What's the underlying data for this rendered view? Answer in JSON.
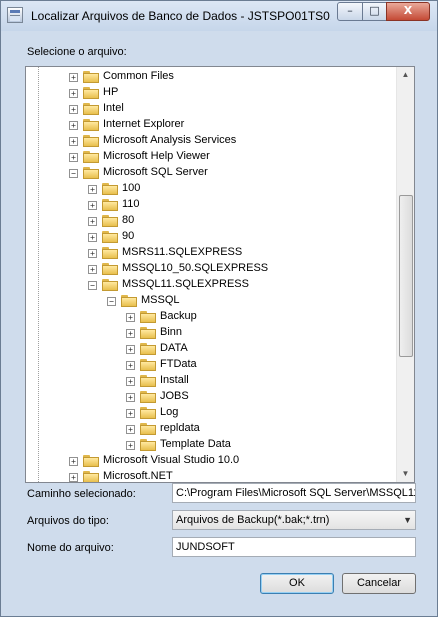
{
  "window": {
    "title": "Localizar Arquivos de Banco de Dados - JSTSPO01TS0...",
    "controls": {
      "minimize": "–",
      "maximize": "□",
      "close": "X"
    }
  },
  "tree_label": "Selecione o arquivo:",
  "tree_items": [
    {
      "label": "Common Files",
      "expander": "+"
    },
    {
      "label": "HP",
      "expander": "+"
    },
    {
      "label": "Intel",
      "expander": "+"
    },
    {
      "label": "Internet Explorer",
      "expander": "+"
    },
    {
      "label": "Microsoft Analysis Services",
      "expander": "+"
    },
    {
      "label": "Microsoft Help Viewer",
      "expander": "+"
    },
    {
      "label": "Microsoft SQL Server",
      "expander": "−"
    },
    {
      "label": "100",
      "expander": "+"
    },
    {
      "label": "110",
      "expander": "+"
    },
    {
      "label": "80",
      "expander": "+"
    },
    {
      "label": "90",
      "expander": "+"
    },
    {
      "label": "MSRS11.SQLEXPRESS",
      "expander": "+"
    },
    {
      "label": "MSSQL10_50.SQLEXPRESS",
      "expander": "+"
    },
    {
      "label": "MSSQL11.SQLEXPRESS",
      "expander": "−"
    },
    {
      "label": "MSSQL",
      "expander": "−"
    },
    {
      "label": "Backup",
      "expander": "+"
    },
    {
      "label": "Binn",
      "expander": "+"
    },
    {
      "label": "DATA",
      "expander": "+"
    },
    {
      "label": "FTData",
      "expander": "+"
    },
    {
      "label": "Install",
      "expander": "+"
    },
    {
      "label": "JOBS",
      "expander": "+"
    },
    {
      "label": "Log",
      "expander": "+"
    },
    {
      "label": "repldata",
      "expander": "+"
    },
    {
      "label": "Template Data",
      "expander": "+"
    },
    {
      "label": "Microsoft Visual Studio 10.0",
      "expander": "+"
    },
    {
      "label": "Microsoft.NET",
      "expander": "+"
    }
  ],
  "scrollbar": {
    "up": "▲",
    "down": "▼"
  },
  "path": {
    "label": "Caminho selecionado:",
    "value": "C:\\Program Files\\Microsoft SQL Server\\MSSQL11"
  },
  "file_type": {
    "label": "Arquivos do tipo:",
    "value": "Arquivos de Backup(*.bak;*.trn)",
    "arrow": "▼"
  },
  "file_name": {
    "label": "Nome do arquivo:",
    "value": "JUNDSOFT"
  },
  "buttons": {
    "ok": "OK",
    "cancel": "Cancelar"
  }
}
